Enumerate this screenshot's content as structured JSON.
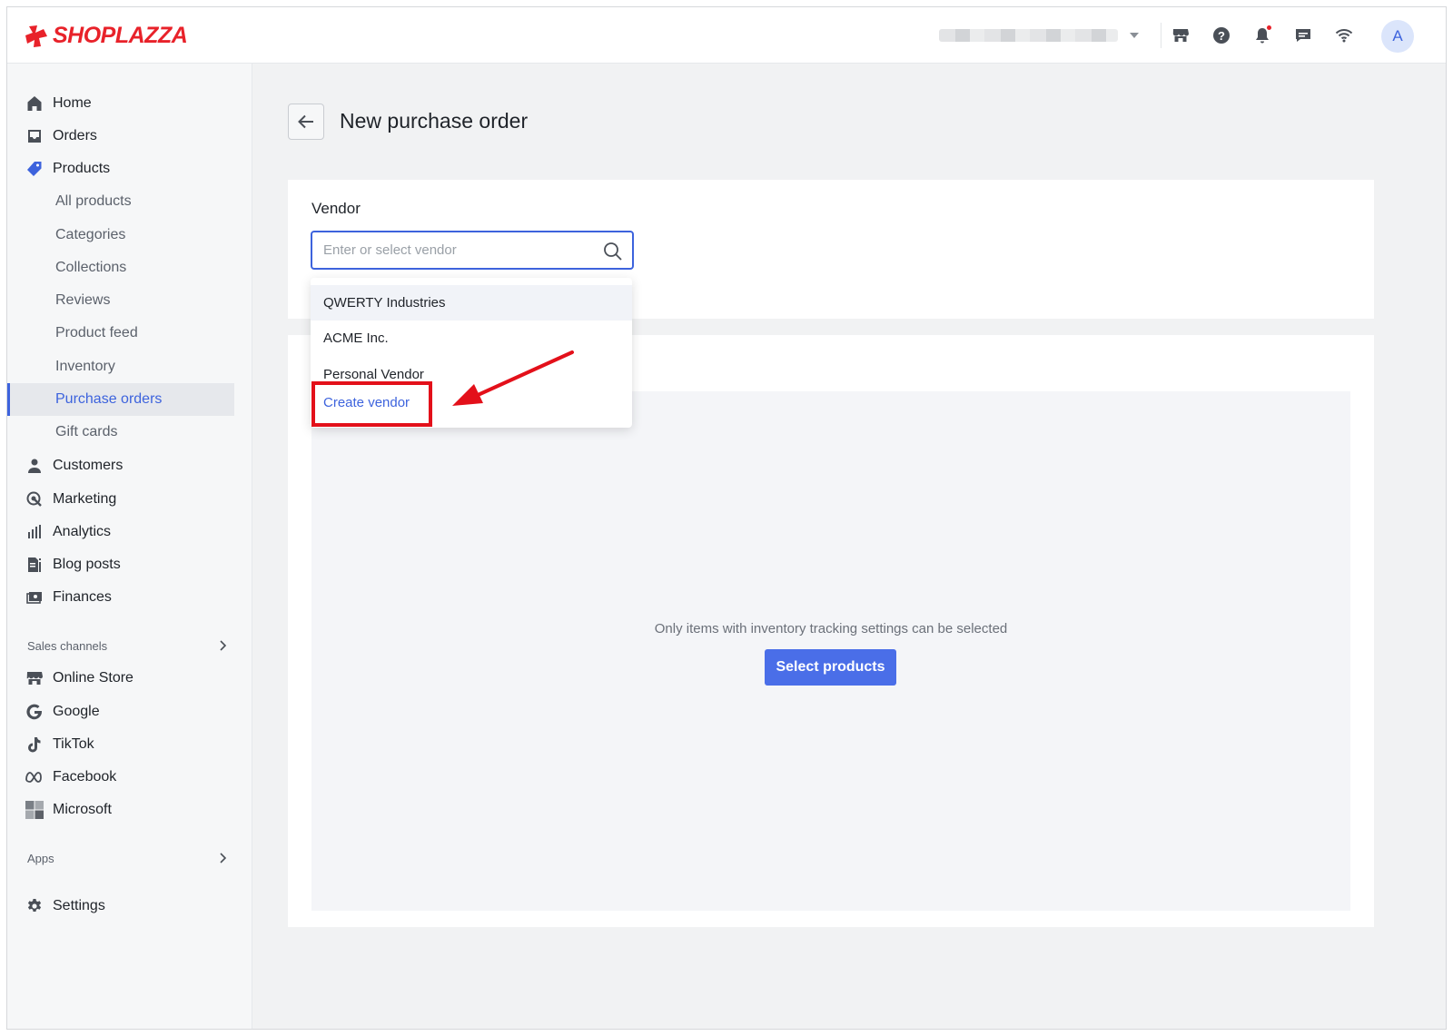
{
  "app": {
    "brand": "SHOPLAZZA"
  },
  "header": {
    "store_name": "",
    "avatar_initial": "A",
    "icons": [
      "store-icon",
      "help-icon",
      "bell-icon",
      "chat-icon",
      "wifi-icon"
    ],
    "accent": "#3d63dd"
  },
  "sidebar": {
    "items": [
      {
        "label": "Home",
        "icon": "home-icon"
      },
      {
        "label": "Orders",
        "icon": "inbox-icon"
      },
      {
        "label": "Products",
        "icon": "tag-icon"
      }
    ],
    "product_subitems": [
      {
        "label": "All products"
      },
      {
        "label": "Categories"
      },
      {
        "label": "Collections"
      },
      {
        "label": "Reviews"
      },
      {
        "label": "Product feed"
      },
      {
        "label": "Inventory"
      },
      {
        "label": "Purchase orders"
      },
      {
        "label": "Gift cards"
      }
    ],
    "items_after": [
      {
        "label": "Customers",
        "icon": "person-icon"
      },
      {
        "label": "Marketing",
        "icon": "marketing-icon"
      },
      {
        "label": "Analytics",
        "icon": "bar-chart-icon"
      },
      {
        "label": "Blog posts",
        "icon": "blog-icon"
      },
      {
        "label": "Finances",
        "icon": "finance-icon"
      }
    ],
    "sales_channels_label": "Sales channels",
    "channels": [
      {
        "label": "Online Store",
        "icon": "store-icon"
      },
      {
        "label": "Google",
        "icon": "google-icon"
      },
      {
        "label": "TikTok",
        "icon": "tiktok-icon"
      },
      {
        "label": "Facebook",
        "icon": "meta-icon"
      },
      {
        "label": "Microsoft",
        "icon": "microsoft-icon"
      }
    ],
    "apps_label": "Apps",
    "settings_label": "Settings"
  },
  "main": {
    "title": "New purchase order",
    "vendor": {
      "label": "Vendor",
      "placeholder": "Enter or select vendor",
      "value": "",
      "options": [
        "QWERTY Industries",
        "ACME Inc.",
        "Personal Vendor"
      ],
      "create_label": "Create vendor"
    },
    "products": {
      "hint": "Only items with inventory tracking settings can be selected",
      "select_button": "Select products"
    }
  },
  "colors": {
    "primary_button": "#4a6ee8",
    "annotation_red": "#e3101a",
    "brand_red": "#e8222a"
  }
}
